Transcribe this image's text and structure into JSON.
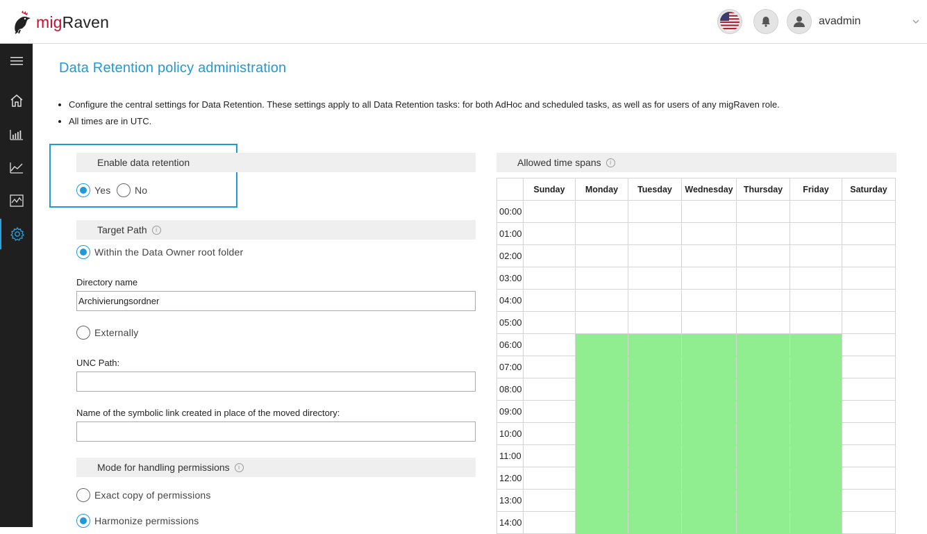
{
  "header": {
    "logo_mig": "mig",
    "logo_raven": "Raven",
    "username": "avadmin"
  },
  "sidebar": {
    "items": [
      {
        "icon": "menu-icon"
      },
      {
        "icon": "home-icon"
      },
      {
        "icon": "bar-chart-icon"
      },
      {
        "icon": "line-chart-icon"
      },
      {
        "icon": "activity-chart-icon"
      },
      {
        "icon": "settings-icon",
        "active": true
      }
    ]
  },
  "page": {
    "title": "Data Retention policy administration",
    "bullets": [
      "Configure the central settings for Data Retention. These settings apply to all Data Retention tasks: for both AdHoc and scheduled tasks, as well as for users of any migRaven role.",
      "All times are in UTC."
    ]
  },
  "enable": {
    "heading": "Enable data retention",
    "yes": "Yes",
    "no": "No",
    "selected": "Yes"
  },
  "target_path": {
    "heading": "Target Path",
    "option_within": "Within the Data Owner root folder",
    "dir_label": "Directory name",
    "dir_value": "Archivierungsordner",
    "option_external": "Externally",
    "unc_label": "UNC Path:",
    "unc_value": "",
    "symlink_label": "Name of the symbolic link created in place of the moved directory:",
    "symlink_value": "",
    "selected": "Within the Data Owner root folder"
  },
  "permissions": {
    "heading": "Mode for handling permissions",
    "option_exact": "Exact copy of permissions",
    "option_harmonize": "Harmonize permissions",
    "selected": "Harmonize permissions"
  },
  "time_spans": {
    "heading": "Allowed time spans",
    "days": [
      "Sunday",
      "Monday",
      "Tuesday",
      "Wednesday",
      "Thursday",
      "Friday",
      "Saturday"
    ],
    "hours": [
      "00:00",
      "01:00",
      "02:00",
      "03:00",
      "04:00",
      "05:00",
      "06:00",
      "07:00",
      "08:00",
      "09:00",
      "10:00",
      "11:00",
      "12:00",
      "13:00",
      "14:00"
    ],
    "allowed_days": [
      "Monday",
      "Tuesday",
      "Wednesday",
      "Thursday",
      "Friday"
    ],
    "allowed_from_hour": "06:00",
    "allowed_color": "#90ee90"
  },
  "colors": {
    "accent": "#1e9ad6",
    "sidebar_bg": "#1f1f1f",
    "brand_red": "#c8102e"
  }
}
